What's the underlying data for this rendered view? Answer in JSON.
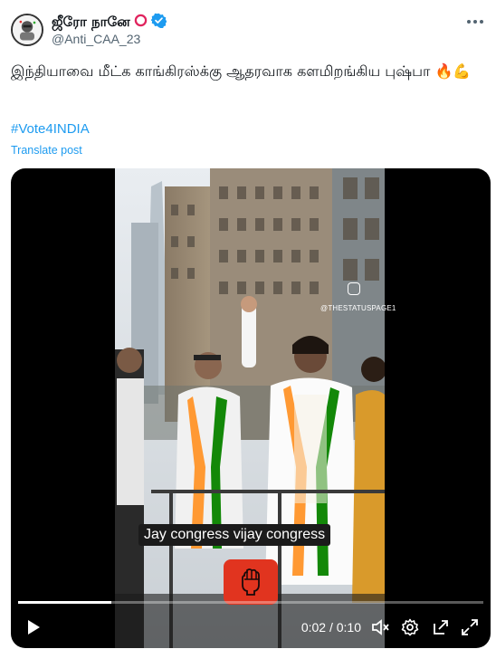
{
  "author": {
    "display_name": "ஜீரோ நானே",
    "handle": "@Anti_CAA_23",
    "badge_color": "#1d9bf0"
  },
  "tweet": {
    "text": "இந்தியாவை மீட்க காங்கிரஸ்க்கு ஆதரவாக களமிறங்கிய புஷ்பா 🔥💪",
    "hashtag": "#Vote4INDIA",
    "translate_label": "Translate post"
  },
  "video": {
    "watermark": "@THESTATUSPAGE1",
    "caption": "Jay congress vijay congress",
    "current_time": "0:02",
    "duration": "0:10",
    "time_display": "0:02 / 0:10",
    "progress": 0.2
  },
  "colors": {
    "link": "#1d9bf0",
    "secondary_text": "#536471",
    "badge_red": "#e1341f"
  }
}
